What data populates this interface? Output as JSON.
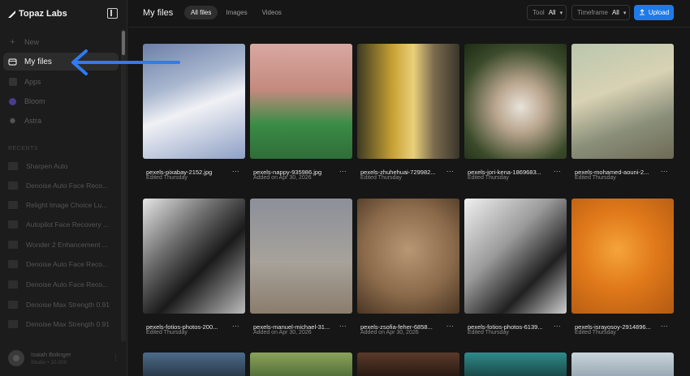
{
  "brand": {
    "name": "Topaz Labs"
  },
  "sidebar": {
    "nav": [
      {
        "label": "New",
        "icon": "plus-icon"
      },
      {
        "label": "My files",
        "icon": "folder-icon",
        "active": true
      },
      {
        "label": "Apps",
        "icon": "apps-icon"
      },
      {
        "label": "Bloom",
        "icon": "bloom-icon"
      },
      {
        "label": "Astra",
        "icon": "astra-icon"
      }
    ],
    "section_label": "RECENTS",
    "recents": [
      "Sharpen Auto",
      "Denoise Auto Face Reco...",
      "Relight Image Choice Lu...",
      "Autopilot Face Recovery ...",
      "Wonder 2 Enhancement ...",
      "Denoise Auto Face Reco...",
      "Denoise Auto Face Reco...",
      "Denoise Max Strength 0.91",
      "Denoise Max Strength 0.91"
    ],
    "user": {
      "name": "Isaiah Bolinger",
      "plan": "Studio • 10,000"
    }
  },
  "header": {
    "title": "My files",
    "tabs": [
      {
        "label": "All files",
        "active": true
      },
      {
        "label": "Images"
      },
      {
        "label": "Videos"
      }
    ],
    "filters": [
      {
        "label": "Tool",
        "value": "All"
      },
      {
        "label": "Timeframe",
        "value": "All"
      }
    ],
    "upload_label": "Upload"
  },
  "files": [
    {
      "name": "pexels-pixabay-2152.jpg",
      "meta": "Edited Thursday"
    },
    {
      "name": "pexels-nappy-935986.jpg",
      "meta": "Added on Apr 30, 2026"
    },
    {
      "name": "pexels-zhuhehuai-729982...",
      "meta": "Edited Thursday"
    },
    {
      "name": "pexels-jori-kena-1869683...",
      "meta": "Edited Thursday"
    },
    {
      "name": "pexels-mohamed-aouni-2...",
      "meta": "Edited Thursday"
    },
    {
      "name": "pexels-fotios-photos-200...",
      "meta": "Edited Thursday"
    },
    {
      "name": "pexels-manuel-michael-31...",
      "meta": "Added on Apr 30, 2026"
    },
    {
      "name": "pexels-zsofia-feher-6858...",
      "meta": "Added on Apr 30, 2026"
    },
    {
      "name": "pexels-fotios-photos-6139...",
      "meta": "Edited Thursday"
    },
    {
      "name": "pexels-israyosoy-2914896...",
      "meta": "Edited Thursday"
    }
  ],
  "more_label": "...",
  "colors": {
    "accent": "#1f7ae8",
    "arrow": "#2f7bf0",
    "background": "#161616",
    "sidebar": "#1c1c1c"
  }
}
